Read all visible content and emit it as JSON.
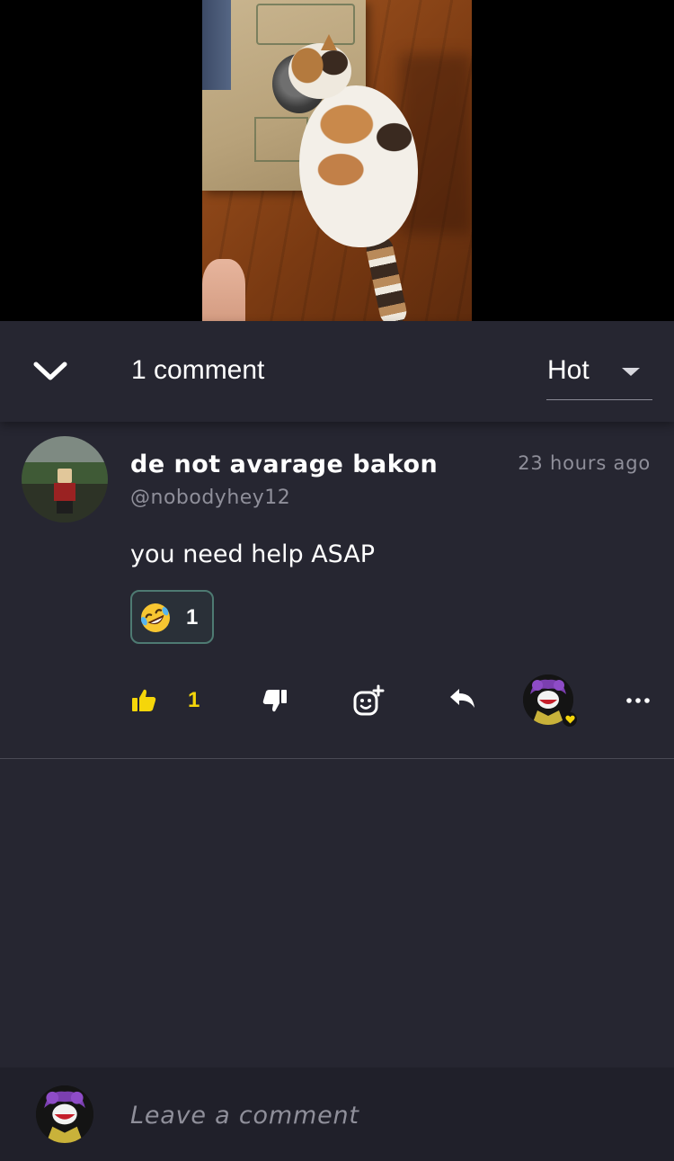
{
  "header": {
    "comment_count_label": "1 comment",
    "sort_selected": "Hot"
  },
  "comment": {
    "display_name": "de not avarage bakon",
    "handle": "@nobodyhey12",
    "timestamp": "23 hours ago",
    "text": "you need help ASAP",
    "reaction": {
      "emoji_name": "rolling-on-floor-laughing-emoji",
      "count": "1"
    },
    "like_count": "1"
  },
  "composer": {
    "placeholder": "Leave a comment"
  },
  "colors": {
    "background": "#262631",
    "composer_background": "#20202a",
    "accent_yellow": "#f5d60a",
    "muted_text": "#8f8f9a",
    "reaction_border": "#4e7a72"
  },
  "icons": {
    "collapse": "chevron-down-icon",
    "sort_caret": "caret-down-icon",
    "like": "thumbs-up-icon",
    "dislike": "thumbs-down-icon",
    "add_reaction": "add-emoji-icon",
    "reply": "reply-arrow-icon",
    "more": "more-horizontal-icon"
  }
}
